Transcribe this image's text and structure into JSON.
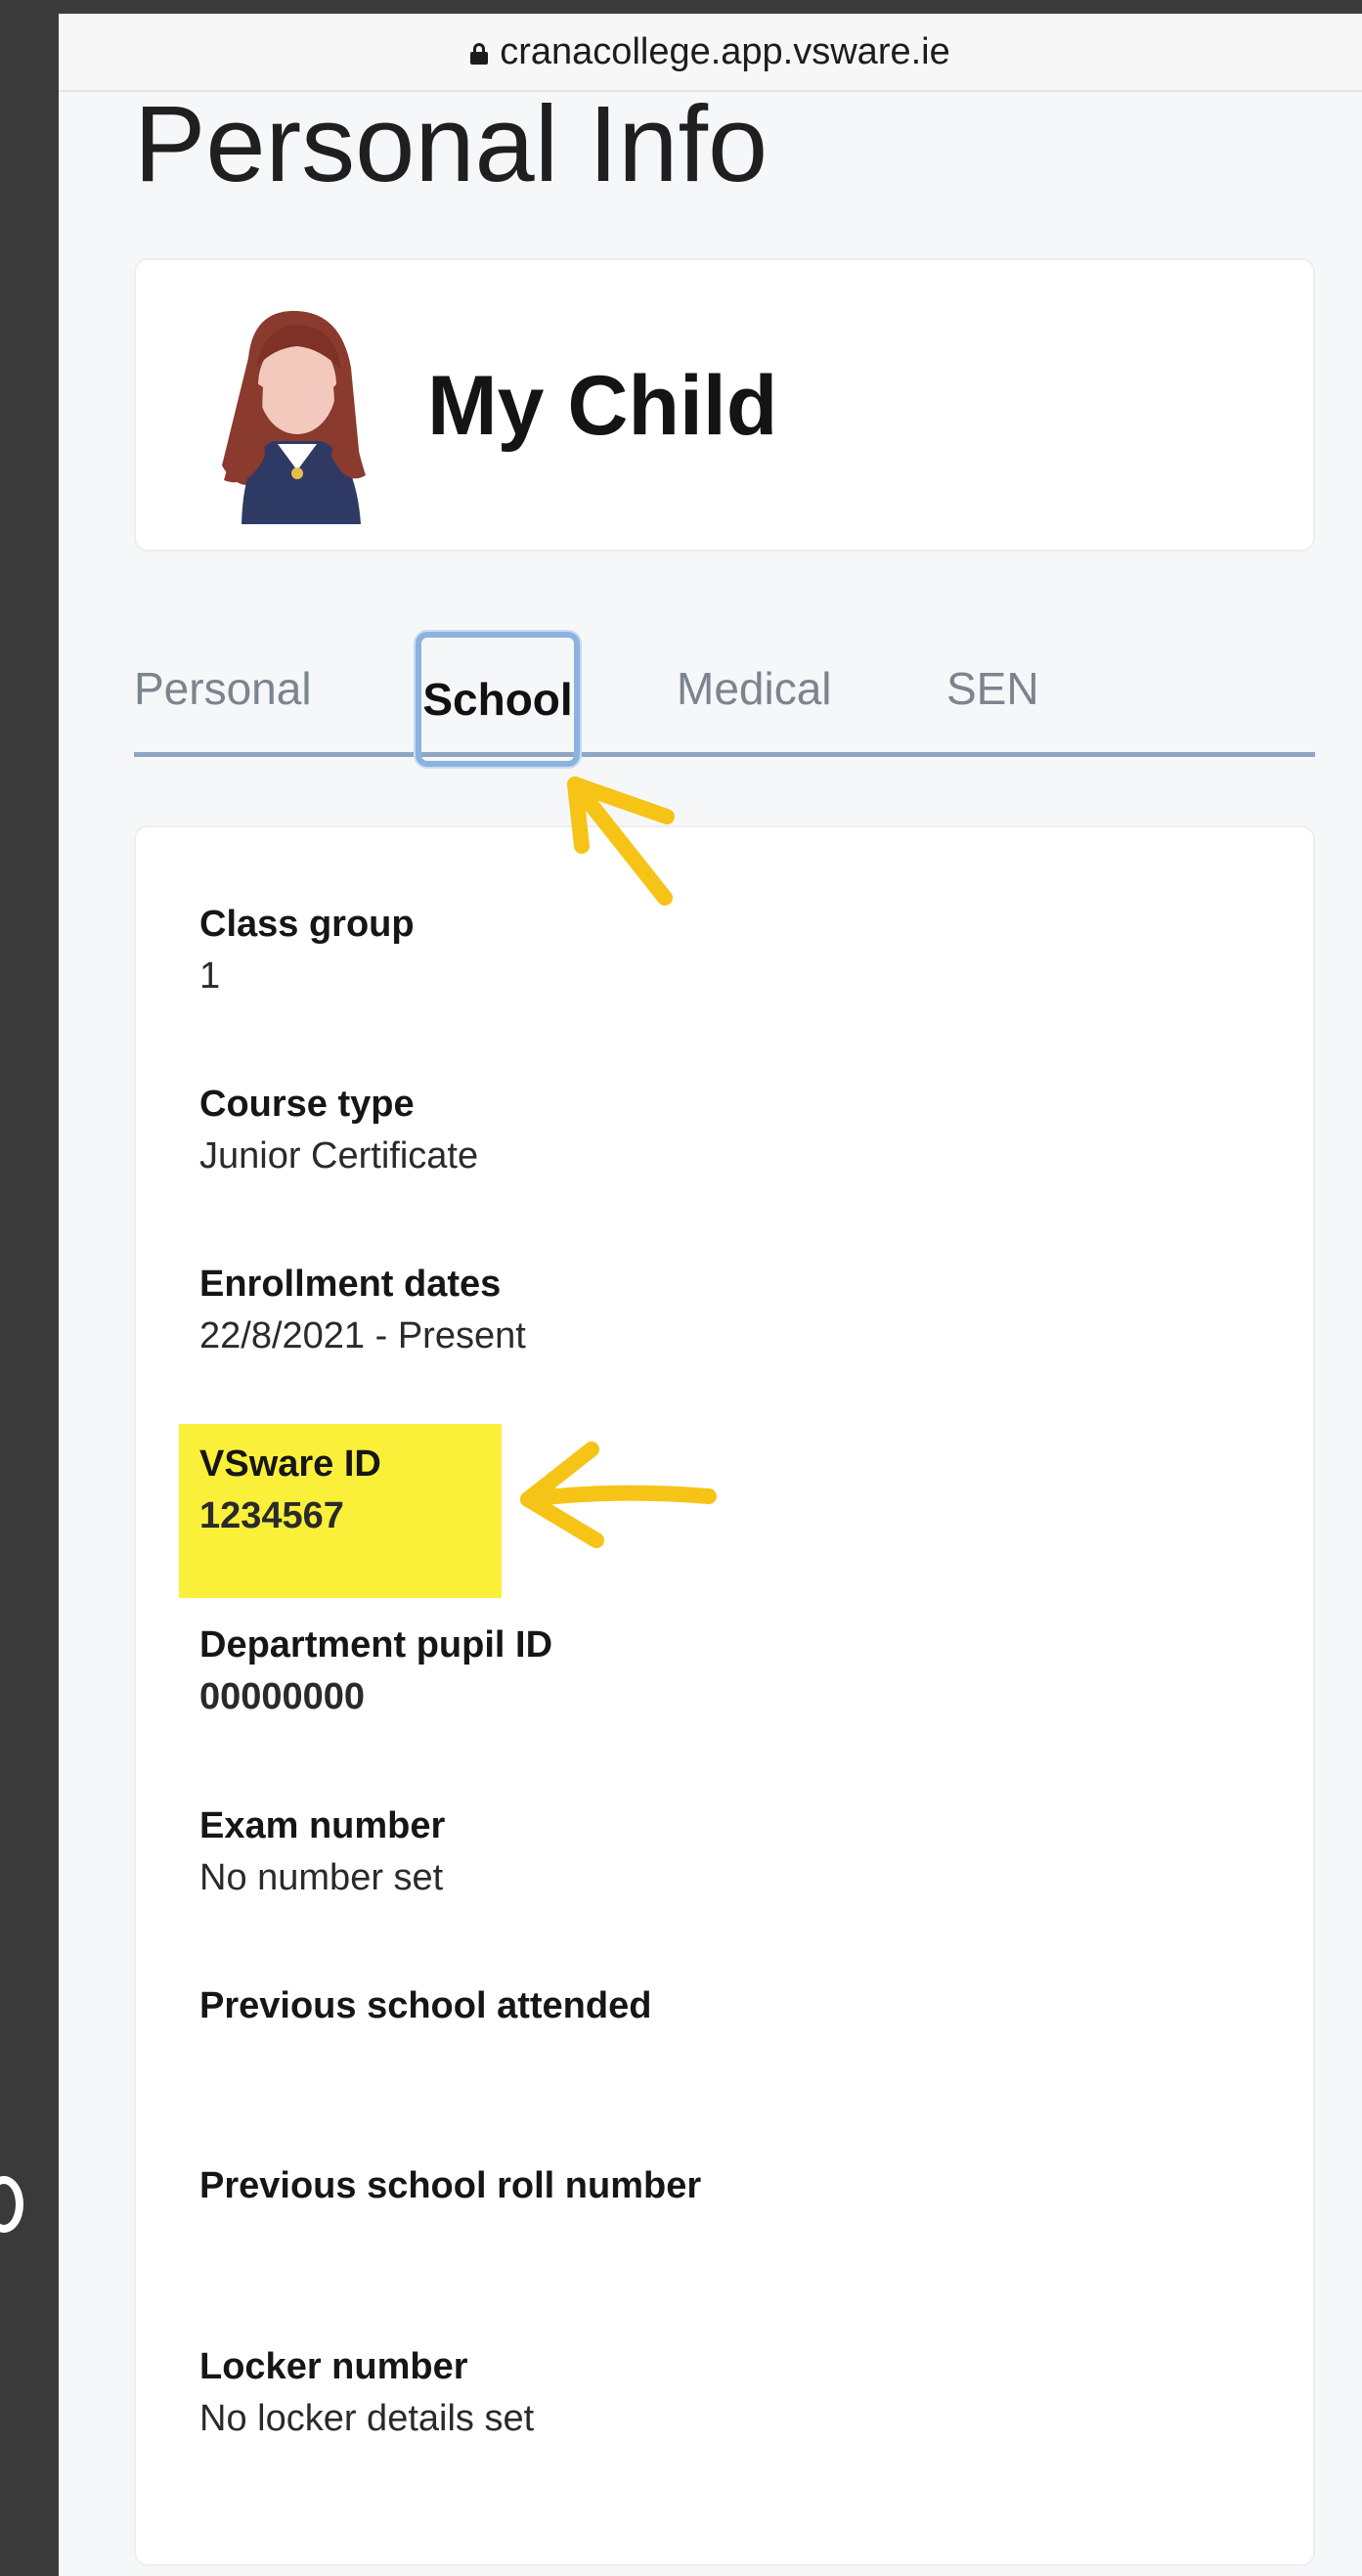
{
  "browser": {
    "url": "cranacollege.app.vsware.ie"
  },
  "page": {
    "title": "Personal Info"
  },
  "profile": {
    "name": "My Child"
  },
  "tabs": [
    {
      "label": "Personal",
      "active": false
    },
    {
      "label": "School",
      "active": true
    },
    {
      "label": "Medical",
      "active": false
    },
    {
      "label": "SEN",
      "active": false
    }
  ],
  "fields": [
    {
      "label": "Class group",
      "value": "1"
    },
    {
      "label": "Course type",
      "value": "Junior Certificate"
    },
    {
      "label": "Enrollment dates",
      "value": "22/8/2021 - Present"
    },
    {
      "label": "VSware ID",
      "value": "1234567",
      "highlighted": true
    },
    {
      "label": "Department pupil ID",
      "value": "00000000"
    },
    {
      "label": "Exam number",
      "value": "No number set"
    },
    {
      "label": "Previous school attended",
      "value": ""
    },
    {
      "label": "Previous school roll number",
      "value": ""
    },
    {
      "label": "Locker number",
      "value": "No locker details set"
    }
  ],
  "colors": {
    "highlight": "#faf03a",
    "annotation_arrow": "#f6c417",
    "tab_active_border": "#8cb2de",
    "tab_underline": "#8ea6c4"
  },
  "icons": {
    "url_lock": "lock-icon"
  }
}
